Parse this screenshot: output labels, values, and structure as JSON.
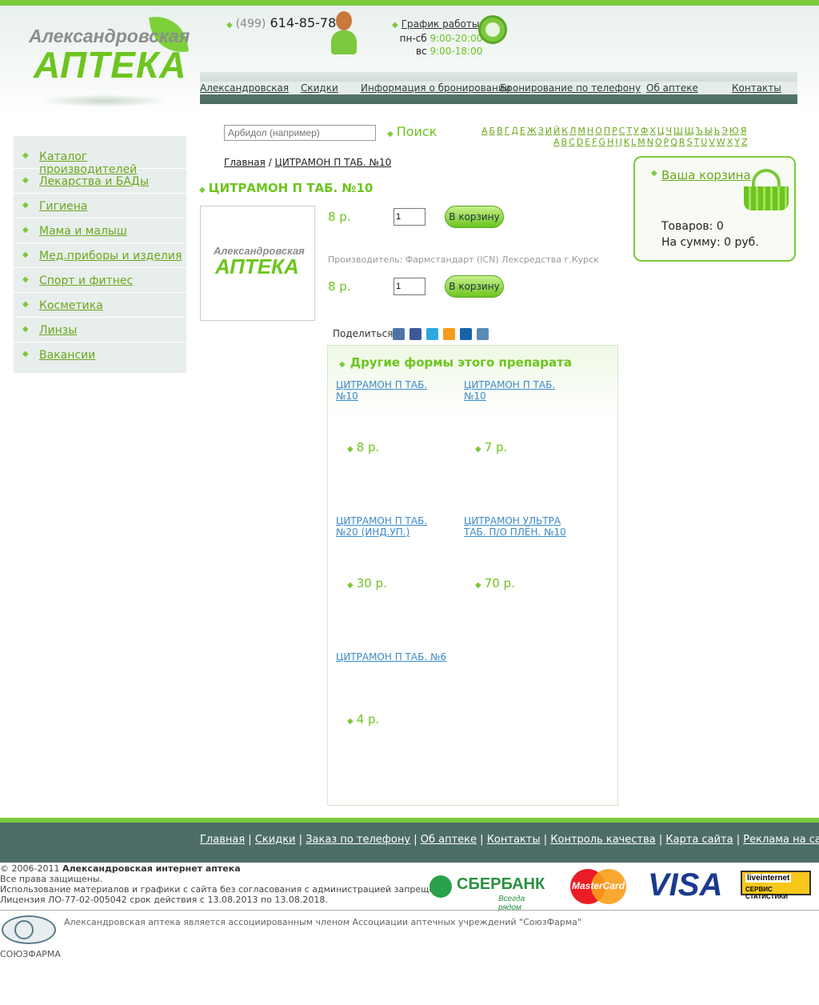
{
  "logo": {
    "line1": "Александровская",
    "line2": "АПТЕКА"
  },
  "header": {
    "phone_code": "(499)",
    "phone_number": "614-85-78",
    "schedule_title": "График работы:",
    "weekdays_label": "пн-сб",
    "weekdays_hours": "9:00-20:00",
    "sunday_label": "вс",
    "sunday_hours": "9:00-18:00"
  },
  "nav": [
    "Александровская",
    "Скидки",
    "Информация о бронировании",
    "Бронирование по телефону",
    "Об аптеке",
    "Контакты"
  ],
  "sidebar": [
    "Каталог производителей",
    "Лекарства и БАДы",
    "Гигиена",
    "Мама и малыш",
    "Мед.приборы и изделия",
    "Спорт и фитнес",
    "Косметика",
    "Линзы",
    "Вакансии"
  ],
  "search": {
    "placeholder": "Арбидол (например)",
    "button": "Поиск"
  },
  "alphabet_ru": [
    "А",
    "Б",
    "В",
    "Г",
    "Д",
    "Е",
    "Ж",
    "З",
    "И",
    "Й",
    "К",
    "Л",
    "М",
    "Н",
    "О",
    "П",
    "Р",
    "С",
    "Т",
    "У",
    "Ф",
    "Х",
    "Ц",
    "Ч",
    "Ш",
    "Щ",
    "Ъ",
    "Ы",
    "Ь",
    "Э",
    "Ю",
    "Я"
  ],
  "alphabet_en": [
    "A",
    "B",
    "C",
    "D",
    "E",
    "F",
    "G",
    "H",
    "I",
    "J",
    "K",
    "L",
    "M",
    "N",
    "O",
    "P",
    "Q",
    "R",
    "S",
    "T",
    "U",
    "V",
    "W",
    "X",
    "Y",
    "Z"
  ],
  "breadcrumb": {
    "home": "Главная",
    "sep": "/",
    "current": "ЦИТРАМОН П ТАБ. №10"
  },
  "product": {
    "title": "ЦИТРАМОН П ТАБ. №10",
    "image_logo1": "Александровская",
    "image_logo2": "АПТЕКА",
    "offers": [
      {
        "price": "8 р.",
        "qty": "1",
        "button": "В корзину"
      },
      {
        "price": "8 р.",
        "qty": "1",
        "button": "В корзину"
      }
    ],
    "maker": "Производитель: Фармстандарт (ICN) Лексредства г.Курск",
    "share_label": "Поделиться"
  },
  "cart": {
    "title": "Ваша корзина",
    "items_label": "Товаров:",
    "items_value": "0",
    "sum_label": "На сумму:",
    "sum_value": "0 руб."
  },
  "other_forms": {
    "title": "Другие формы этого препарата",
    "items": [
      {
        "name": "ЦИТРАМОН П ТАБ. №10",
        "price": "8 р."
      },
      {
        "name": "ЦИТРАМОН П ТАБ. №10",
        "price": "7 р."
      },
      {
        "name": "ЦИТРАМОН П ТАБ. №20 (ИНД.УП.)",
        "price": "30 р."
      },
      {
        "name": "ЦИТРАМОН УЛЬТРА ТАБ. П/О ПЛЁН. №10",
        "price": "70 р."
      },
      {
        "name": "ЦИТРАМОН П ТАБ. №6",
        "price": "4 р."
      }
    ]
  },
  "footer": {
    "links": [
      "Главная",
      "Скидки",
      "Заказ по телефону",
      "Об аптеке",
      "Контакты",
      "Контроль качества",
      "Карта сайта",
      "Реклама на сайте"
    ],
    "sep": "|",
    "copyright_prefix": "© 2006-2011",
    "copyright_name": "Александровская интернет аптека",
    "rights": "Все права защищены.",
    "usage": "Использование материалов и графики с сайта без согласования с администрацией запрещено.",
    "license": "Лицензия ЛО-77-02-005042 срок действия с 13.08.2013 по 13.08.2018.",
    "sber_name": "СБЕРБАНК",
    "sber_slogan": "Всегда рядом",
    "mastercard": "MasterCard",
    "visa": "VISA",
    "li_top": "liveinternet",
    "li_bottom": "СЕРВИС СТАТИСТИКИ",
    "sojuz_label": "СОЮЗФАРМА",
    "association": "Александровская аптека является ассоциированным членом Ассоциации аптечных учреждений \"СоюзФарма\""
  }
}
